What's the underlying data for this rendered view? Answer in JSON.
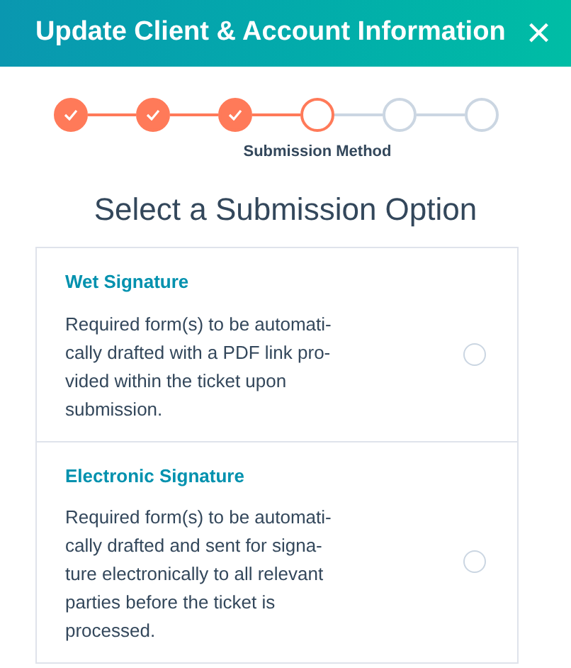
{
  "header": {
    "title": "Update Client & Account Information",
    "close": "×"
  },
  "steps": [
    {
      "completed": true,
      "current": false
    },
    {
      "completed": true,
      "current": false
    },
    {
      "completed": true,
      "current": false
    },
    {
      "completed": false,
      "current": true,
      "label": "Submission Method"
    },
    {
      "completed": false,
      "current": false
    },
    {
      "completed": false,
      "current": false
    }
  ],
  "heading": "Select a Submission Option",
  "options": [
    {
      "title": "Wet Signature",
      "lines": [
        "Required form(s) to be automati-",
        "cally drafted with a PDF link pro-",
        "vided within the ticket upon",
        "submission."
      ],
      "selected": false
    },
    {
      "title": "Electronic Signature",
      "lines": [
        "Required form(s) to be automati-",
        "cally drafted and sent for signa-",
        "ture electronically to all relevant",
        "parties before the ticket is",
        "processed."
      ],
      "selected": false
    }
  ]
}
